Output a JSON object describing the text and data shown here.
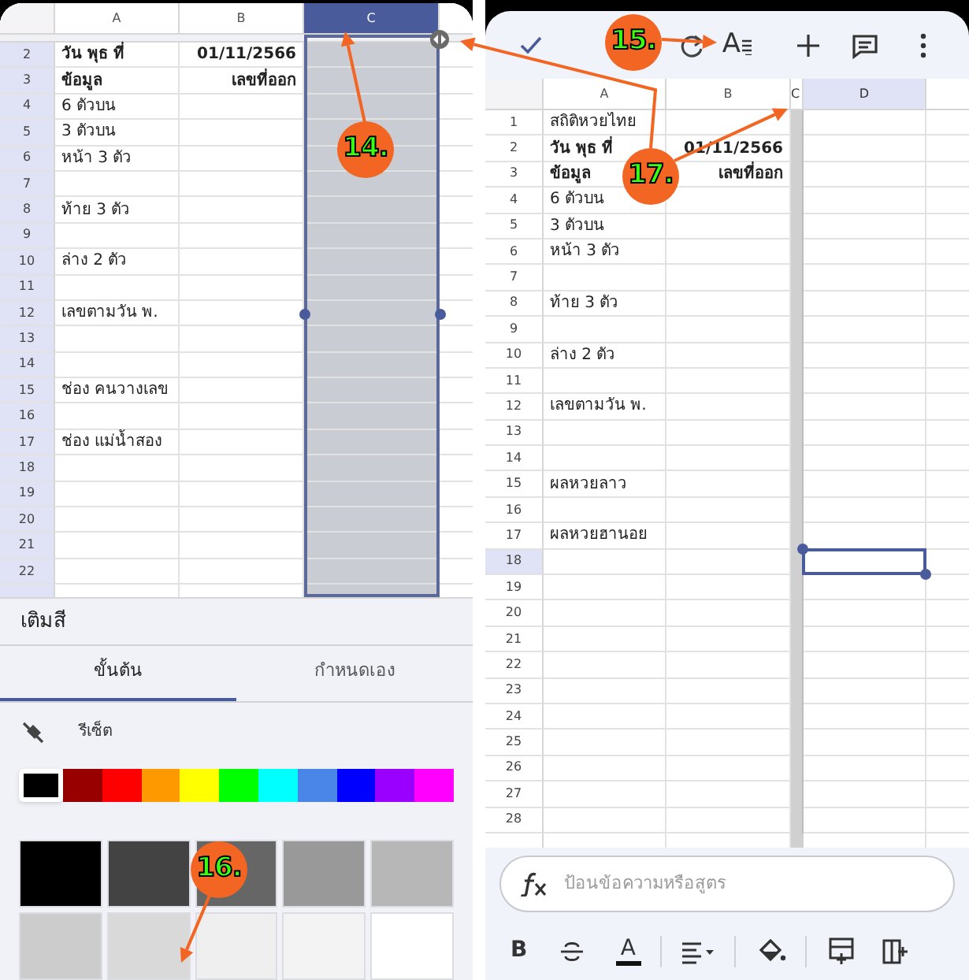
{
  "left_screen": {
    "sheet": {
      "columns": [
        {
          "label": "A",
          "selected": false
        },
        {
          "label": "B",
          "selected": false
        },
        {
          "label": "C",
          "selected": true
        }
      ],
      "rows": [
        {
          "number": "2",
          "cells": [
            "วัน พุธ ที่",
            "01/11/2566"
          ],
          "bold": true
        },
        {
          "number": "3",
          "cells": [
            "ข้อมูล",
            "เลขที่ออก"
          ],
          "bold": true
        },
        {
          "number": "4",
          "cells": [
            "6 ตัวบน"
          ],
          "bold": false
        },
        {
          "number": "5",
          "cells": [
            "3 ตัวบน"
          ],
          "bold": false
        },
        {
          "number": "6",
          "cells": [
            "หน้า 3 ตัว"
          ],
          "bold": false
        },
        {
          "number": "7"
        },
        {
          "number": "8",
          "cells": [
            "ท้าย 3 ตัว"
          ],
          "bold": false
        },
        {
          "number": "9"
        },
        {
          "number": "10",
          "cells": [
            "ล่าง 2 ตัว"
          ],
          "bold": false
        },
        {
          "number": "11"
        },
        {
          "number": "12",
          "cells": [
            "เลขตามวัน พ."
          ],
          "bold": false
        },
        {
          "number": "13"
        },
        {
          "number": "14"
        },
        {
          "number": "15",
          "cells": [
            "ช่อง คนวางเลข"
          ],
          "bold": false
        },
        {
          "number": "16"
        },
        {
          "number": "17",
          "cells": [
            "ช่อง แม่น้ำสอง"
          ],
          "bold": false
        },
        {
          "number": "18"
        },
        {
          "number": "19"
        },
        {
          "number": "20"
        },
        {
          "number": "21"
        },
        {
          "number": "22"
        }
      ]
    },
    "fill_panel": {
      "title": "เติมสี",
      "tabs": [
        {
          "label": "ขั้นต้น",
          "selected": true
        },
        {
          "label": "กำหนดเอง",
          "selected": false
        }
      ],
      "reset_label": "รีเซ็ต",
      "palette": [
        {
          "color": "#000000",
          "selected": true
        },
        {
          "color": "#980000",
          "selected": false
        },
        {
          "color": "#ff0000",
          "selected": false
        },
        {
          "color": "#ff9900",
          "selected": false
        },
        {
          "color": "#ffff00",
          "selected": false
        },
        {
          "color": "#00ff00",
          "selected": false
        },
        {
          "color": "#00ffff",
          "selected": false
        },
        {
          "color": "#4a86e8",
          "selected": false
        },
        {
          "color": "#0000ff",
          "selected": false
        },
        {
          "color": "#9900ff",
          "selected": false
        },
        {
          "color": "#ff00ff",
          "selected": false
        }
      ],
      "shades": [
        {
          "color": "#000000"
        },
        {
          "color": "#434343"
        },
        {
          "color": "#666666"
        },
        {
          "color": "#999999"
        },
        {
          "color": "#b7b7b7"
        },
        {
          "color": "#cccccc"
        },
        {
          "color": "#d9d9d9"
        },
        {
          "color": "#efefef"
        },
        {
          "color": "#f3f3f3"
        },
        {
          "color": "#ffffff"
        }
      ]
    }
  },
  "right_screen": {
    "toolbar": {
      "text_format_glyph": "A"
    },
    "sheet": {
      "columns": [
        {
          "label": "A",
          "selected": false,
          "collapsed": false
        },
        {
          "label": "B",
          "selected": false,
          "collapsed": false
        },
        {
          "label": "C",
          "selected": false,
          "collapsed": true
        },
        {
          "label": "D",
          "selected": true,
          "collapsed": false
        }
      ],
      "rows": [
        {
          "number": "1",
          "cells": [
            "สถิติหวยไทย"
          ],
          "bold": false,
          "selected": false
        },
        {
          "number": "2",
          "cells": [
            "วัน พุธ ที่",
            "01/11/2566"
          ],
          "bold": true,
          "selected": false
        },
        {
          "number": "3",
          "cells": [
            "ข้อมูล",
            "เลขที่ออก"
          ],
          "bold": true,
          "selected": false
        },
        {
          "number": "4",
          "cells": [
            "6 ตัวบน"
          ],
          "bold": false,
          "selected": false
        },
        {
          "number": "5",
          "cells": [
            "3 ตัวบน"
          ],
          "bold": false,
          "selected": false
        },
        {
          "number": "6",
          "cells": [
            "หน้า 3 ตัว"
          ],
          "bold": false,
          "selected": false
        },
        {
          "number": "7",
          "selected": false
        },
        {
          "number": "8",
          "cells": [
            "ท้าย 3 ตัว"
          ],
          "bold": false,
          "selected": false
        },
        {
          "number": "9",
          "selected": false
        },
        {
          "number": "10",
          "cells": [
            "ล่าง 2 ตัว"
          ],
          "bold": false,
          "selected": false
        },
        {
          "number": "11",
          "selected": false
        },
        {
          "number": "12",
          "cells": [
            "เลขตามวัน พ."
          ],
          "bold": false,
          "selected": false
        },
        {
          "number": "13",
          "selected": false
        },
        {
          "number": "14",
          "selected": false
        },
        {
          "number": "15",
          "cells": [
            "ผลหวยลาว"
          ],
          "bold": false,
          "selected": false
        },
        {
          "number": "16",
          "selected": false
        },
        {
          "number": "17",
          "cells": [
            "ผลหวยฮานอย"
          ],
          "bold": false,
          "selected": false
        },
        {
          "number": "18",
          "selected": true
        },
        {
          "number": "19",
          "selected": false
        },
        {
          "number": "20",
          "selected": false
        },
        {
          "number": "21",
          "selected": false
        },
        {
          "number": "22",
          "selected": false
        },
        {
          "number": "23",
          "selected": false
        },
        {
          "number": "24",
          "selected": false
        },
        {
          "number": "25",
          "selected": false
        },
        {
          "number": "26",
          "selected": false
        },
        {
          "number": "27",
          "selected": false
        },
        {
          "number": "28",
          "selected": false
        }
      ]
    },
    "formula_bar": {
      "placeholder": "ป้อนข้อความหรือสูตร"
    },
    "format_toolbar": {
      "bold_glyph": "B",
      "text_color_glyph": "A"
    }
  },
  "annotations": [
    {
      "label": "14."
    },
    {
      "label": "15."
    },
    {
      "label": "16."
    },
    {
      "label": "17."
    }
  ]
}
